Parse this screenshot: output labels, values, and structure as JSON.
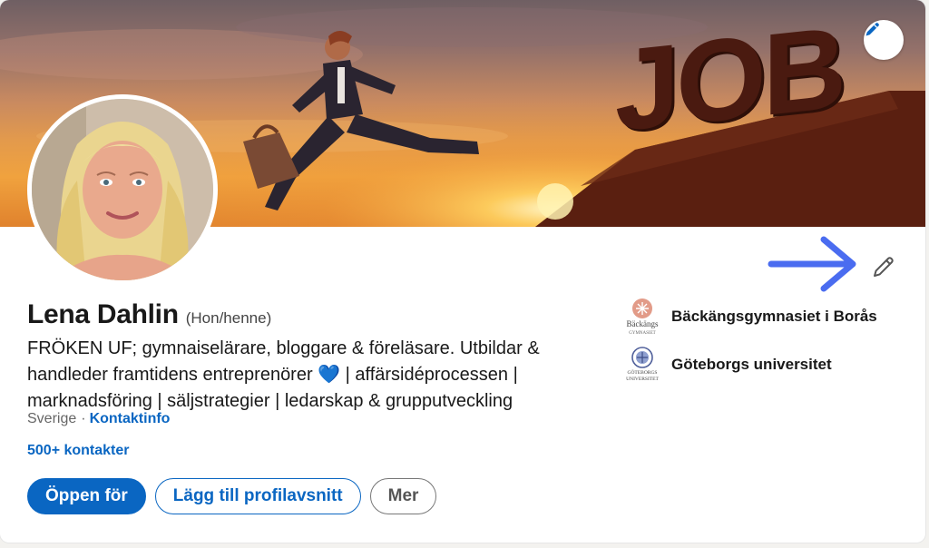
{
  "banner": {
    "job_text": "JOB",
    "edit_icon": "pencil-icon"
  },
  "profile": {
    "name": "Lena Dahlin",
    "pronouns": "(Hon/henne)",
    "headline": "FRÖKEN UF; gymnaiselärare, bloggare & föreläsare. Utbildar & handleder framtidens entreprenörer 💙 | affärsidéprocessen | marknadsföring | säljstrategier | ledarskap & grupputveckling",
    "location": "Sverige",
    "separator": "·",
    "contact_info_label": "Kontaktinfo",
    "connections": "500+ kontakter"
  },
  "actions": {
    "open_to": "Öppen för",
    "add_section": "Lägg till profilavsnitt",
    "more": "Mer"
  },
  "education": [
    {
      "name": "Bäckängsgymnasiet i Borås",
      "logo_text_1": "Bäckängs",
      "logo_text_2": "GYMNASIET"
    },
    {
      "name": "Göteborgs universitet",
      "logo_text_1": "GÖTEBORGS",
      "logo_text_2": "UNIVERSITET"
    }
  ],
  "colors": {
    "accent": "#0a66c2",
    "annotation_arrow": "#4a6cf0"
  }
}
